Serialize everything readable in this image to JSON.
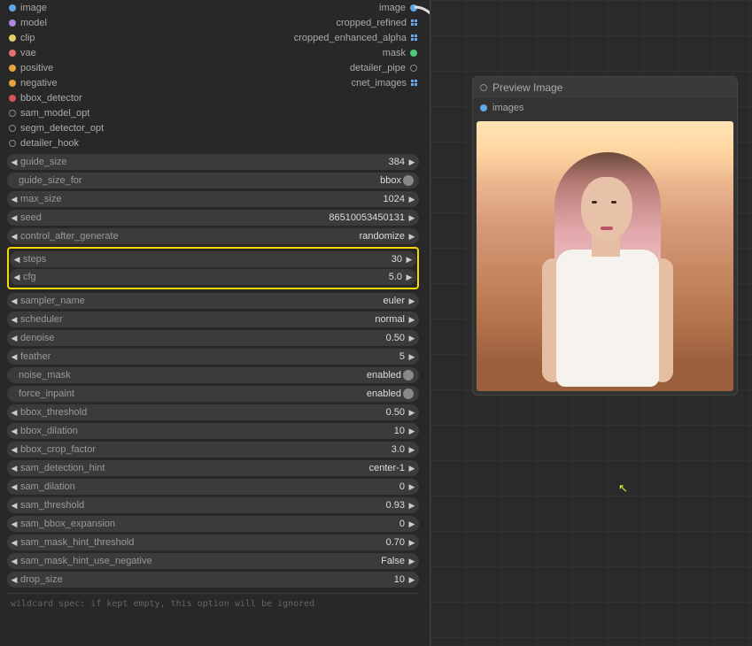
{
  "inputs": [
    {
      "label": "image",
      "color": "#5fa8e8"
    },
    {
      "label": "model",
      "color": "#b186dd"
    },
    {
      "label": "clip",
      "color": "#e6d06c"
    },
    {
      "label": "vae",
      "color": "#e07272"
    },
    {
      "label": "positive",
      "color": "#e8a23c"
    },
    {
      "label": "negative",
      "color": "#e8a23c"
    },
    {
      "label": "bbox_detector",
      "color": "#d95555"
    },
    {
      "label": "sam_model_opt",
      "color": "",
      "ring": true
    },
    {
      "label": "segm_detector_opt",
      "color": "",
      "ring": true
    },
    {
      "label": "detailer_hook",
      "color": "",
      "ring": true
    }
  ],
  "outputs": [
    {
      "label": "image",
      "color": "#5fa8e8",
      "type": "dot"
    },
    {
      "label": "cropped_refined",
      "type": "grid"
    },
    {
      "label": "cropped_enhanced_alpha",
      "type": "grid"
    },
    {
      "label": "mask",
      "color": "#51c878",
      "type": "dot"
    },
    {
      "label": "detailer_pipe",
      "type": "ring"
    },
    {
      "label": "cnet_images",
      "type": "grid"
    }
  ],
  "params": {
    "pre": [
      {
        "name": "guide_size",
        "value": "384",
        "arrows": true
      },
      {
        "name": "guide_size_for",
        "value": "bbox",
        "toggle": true
      },
      {
        "name": "max_size",
        "value": "1024",
        "arrows": true
      },
      {
        "name": "seed",
        "value": "86510053450131",
        "arrows": true
      },
      {
        "name": "control_after_generate",
        "value": "randomize",
        "arrows": true
      }
    ],
    "boxed": [
      {
        "name": "steps",
        "value": "30",
        "arrows": true
      },
      {
        "name": "cfg",
        "value": "5.0",
        "arrows": true
      }
    ],
    "post": [
      {
        "name": "sampler_name",
        "value": "euler",
        "arrows": true
      },
      {
        "name": "scheduler",
        "value": "normal",
        "arrows": true
      },
      {
        "name": "denoise",
        "value": "0.50",
        "arrows": true
      },
      {
        "name": "feather",
        "value": "5",
        "arrows": true
      },
      {
        "name": "noise_mask",
        "value": "enabled",
        "toggle": true
      },
      {
        "name": "force_inpaint",
        "value": "enabled",
        "toggle": true
      },
      {
        "name": "bbox_threshold",
        "value": "0.50",
        "arrows": true
      },
      {
        "name": "bbox_dilation",
        "value": "10",
        "arrows": true
      },
      {
        "name": "bbox_crop_factor",
        "value": "3.0",
        "arrows": true
      },
      {
        "name": "sam_detection_hint",
        "value": "center-1",
        "arrows": true
      },
      {
        "name": "sam_dilation",
        "value": "0",
        "arrows": true
      },
      {
        "name": "sam_threshold",
        "value": "0.93",
        "arrows": true
      },
      {
        "name": "sam_bbox_expansion",
        "value": "0",
        "arrows": true
      },
      {
        "name": "sam_mask_hint_threshold",
        "value": "0.70",
        "arrows": true
      },
      {
        "name": "sam_mask_hint_use_negative",
        "value": "False",
        "arrows": true
      },
      {
        "name": "drop_size",
        "value": "10",
        "arrows": true
      }
    ]
  },
  "footer": "wildcard spec: if kept empty, this option will be ignored",
  "preview": {
    "title": "Preview Image",
    "input": "images"
  }
}
